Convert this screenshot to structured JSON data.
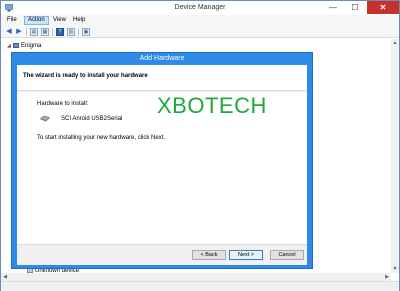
{
  "window": {
    "title": "Device Manager",
    "controls": {
      "minimize": "—",
      "maximize": "☐",
      "close": "✕"
    }
  },
  "menu": {
    "items": [
      {
        "label": "File",
        "active": false
      },
      {
        "label": "Action",
        "active": true
      },
      {
        "label": "View",
        "active": false
      },
      {
        "label": "Help",
        "active": false
      }
    ]
  },
  "toolbar": {
    "icons": [
      "back-arrow-icon",
      "forward-arrow-icon",
      "properties-icon",
      "show-hidden-icon",
      "help-icon",
      "scan-hardware-icon"
    ]
  },
  "tree": {
    "root": {
      "expander": "◢",
      "label": "Enigma"
    },
    "bottom_item": {
      "label": "Unknown device"
    }
  },
  "dialog": {
    "title": "Add Hardware",
    "heading": "The wizard is ready to install your hardware",
    "hardware_label": "Hardware to install:",
    "hardware_name": "SCI Anroid USB2Serial",
    "instruction": "To start installing your new hardware, click Next.",
    "buttons": {
      "back": "< Back",
      "next": "Next >",
      "cancel": "Cancel"
    }
  },
  "watermark": "XBOTECH",
  "colors": {
    "dialog_frame": "#2e8ae6",
    "close_button": "#c7312c",
    "watermark": "#1ea93a"
  }
}
